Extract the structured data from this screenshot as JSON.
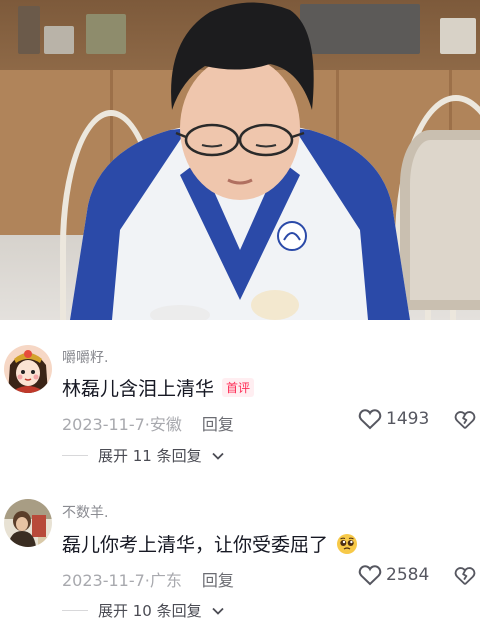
{
  "comments": [
    {
      "username": "嚼嚼籽.",
      "text": "林磊儿含泪上清华",
      "badge": "首评",
      "date_location": "2023-11-7·安徽",
      "reply_label": "回复",
      "likes": "1493",
      "expand_label": "展开 11 条回复"
    },
    {
      "username": "不数羊.",
      "text": "磊儿你考上清华，让你受委屈了",
      "emoji": "pleading-face",
      "date_location": "2023-11-7·广东",
      "reply_label": "回复",
      "likes": "2584",
      "expand_label": "展开 10 条回复"
    }
  ],
  "icons": {
    "like": "heart-outline-icon",
    "dislike": "broken-heart-icon",
    "expand": "chevron-down-icon"
  },
  "colors": {
    "badge": "#fe2c55",
    "text": "#161823",
    "meta": "#a8a9ae",
    "uniform_blue": "#2b4aa8"
  }
}
